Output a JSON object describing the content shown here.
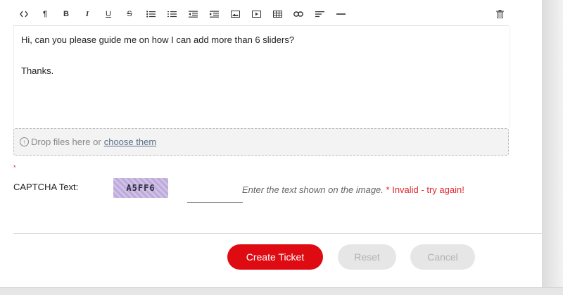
{
  "toolbar": {
    "items": [
      {
        "name": "code-view-icon",
        "glyph": "<>"
      },
      {
        "name": "paragraph-icon",
        "glyph": "¶"
      },
      {
        "name": "bold-icon",
        "glyph": "B"
      },
      {
        "name": "italic-icon",
        "glyph": "I"
      },
      {
        "name": "underline-icon",
        "glyph": "U"
      },
      {
        "name": "strikethrough-icon",
        "glyph": "S"
      },
      {
        "name": "unordered-list-icon",
        "glyph": "bullets"
      },
      {
        "name": "ordered-list-icon",
        "glyph": "numbers"
      },
      {
        "name": "outdent-icon",
        "glyph": "outdent"
      },
      {
        "name": "indent-icon",
        "glyph": "indent"
      },
      {
        "name": "image-icon",
        "glyph": "image"
      },
      {
        "name": "video-icon",
        "glyph": "video"
      },
      {
        "name": "table-icon",
        "glyph": "table"
      },
      {
        "name": "link-icon",
        "glyph": "link"
      },
      {
        "name": "align-icon",
        "glyph": "align"
      },
      {
        "name": "horizontal-rule-icon",
        "glyph": "hr"
      }
    ],
    "delete_icon": "trash-icon"
  },
  "editor": {
    "line1": "Hi, can you please guide me on how I can add more than 6 sliders?",
    "line2": "Thanks."
  },
  "dropzone": {
    "icon": "upload-icon",
    "text": "Drop files here or",
    "link": "choose them"
  },
  "captcha": {
    "required_mark": "*",
    "label": "CAPTCHA Text:",
    "image_text": "A5FF6",
    "input_value": "",
    "hint": "Enter the text shown on the image.",
    "error": "* Invalid - try again!"
  },
  "buttons": {
    "create": "Create Ticket",
    "reset": "Reset",
    "cancel": "Cancel"
  },
  "colors": {
    "accent": "#df0b13",
    "error": "#e0282e",
    "disabled_bg": "#e6e6e6",
    "disabled_text": "#b3b3b3"
  }
}
